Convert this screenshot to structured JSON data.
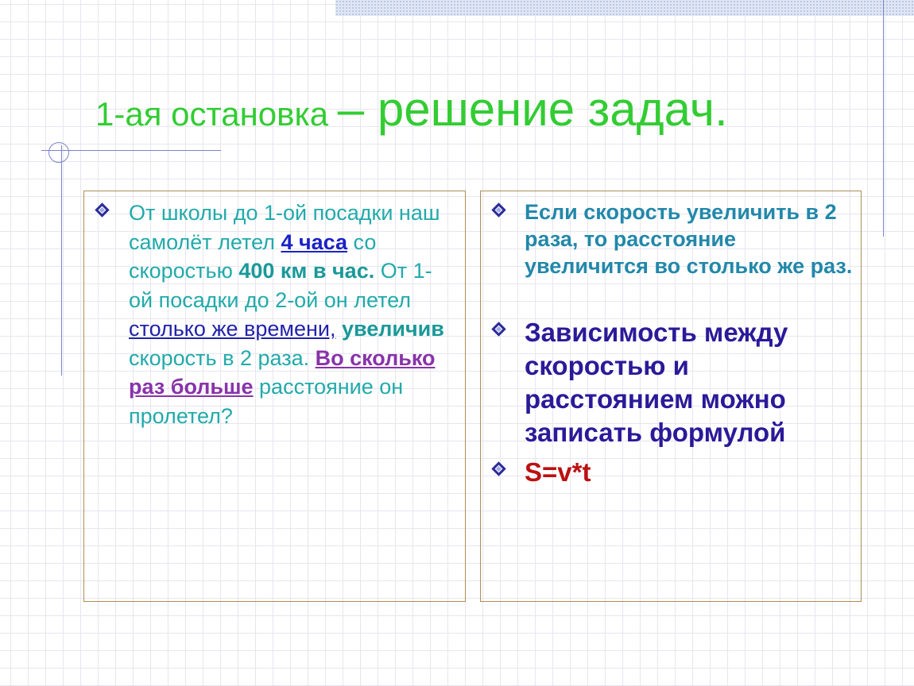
{
  "slide": {
    "title_part1": "1-ая остановка ",
    "title_part2": "– решение задач.",
    "left_panel": {
      "seg1": "От  школы до 1-ой посадки наш самолёт летел ",
      "seg2": "4 часа",
      "seg3": " со скоростью ",
      "seg4": "400 км в час.",
      "seg5": " От 1-ой посадки до 2-ой он летел ",
      "seg6": "столько же времени,",
      "seg7": " ",
      "seg8": "увеличив",
      "seg9": " скорость в 2 раза. ",
      "seg10": "Во сколько раз больше",
      "seg11": " расстояние он пролетел?"
    },
    "right_panel": {
      "item1": "Если скорость увеличить в 2 раза, то расстояние увеличится во столько же раз.",
      "item2": "Зависимость между скоростью и расстоянием можно записать формулой",
      "item3": "S=v*t"
    }
  },
  "colors": {
    "title": "#33cc33",
    "grid": "#e6e6ee",
    "panel_border": "#b08d57",
    "accent_blue": "#1a22c8",
    "accent_purple": "#8833aa",
    "formula_red": "#bb1111"
  },
  "icons": {
    "bullet": "diamond-bullet-icon"
  }
}
